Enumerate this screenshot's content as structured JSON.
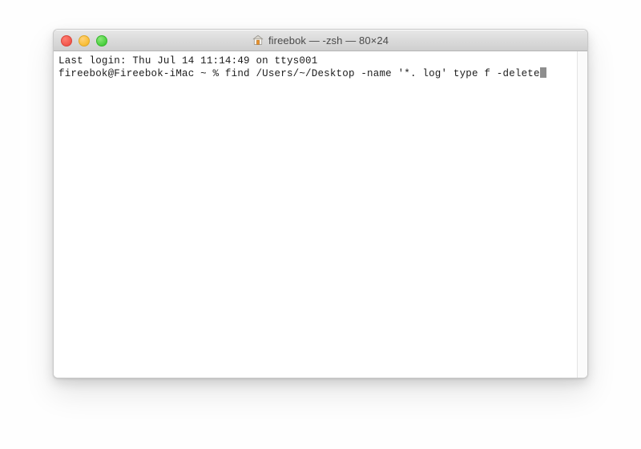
{
  "window": {
    "title": "fireebok — -zsh — 80×24",
    "icon": "home-icon",
    "controls": {
      "close_label": "Close",
      "minimize_label": "Minimize",
      "maximize_label": "Zoom"
    }
  },
  "terminal": {
    "lines": [
      "Last login: Thu Jul 14 11:14:49 on ttys001",
      "fireebok@Fireebok-iMac ~ % find /Users/~/Desktop -name '*. log' type f -delete"
    ],
    "line1": "Last login: Thu Jul 14 11:14:49 on ttys001",
    "line2": "fireebok@Fireebok-iMac ~ % find /Users/~/Desktop -name '*. log' type f -delete",
    "cursor": "block",
    "colors": {
      "text": "#1c1c1c",
      "background": "#ffffff",
      "cursor": "#8e8e8e"
    }
  },
  "chrome": {
    "titlebar_bg_top": "#e8e8e8",
    "titlebar_bg_bottom": "#cfcfcf",
    "close_color": "#f2564b",
    "minimize_color": "#f9bd34",
    "maximize_color": "#49cf3e"
  }
}
